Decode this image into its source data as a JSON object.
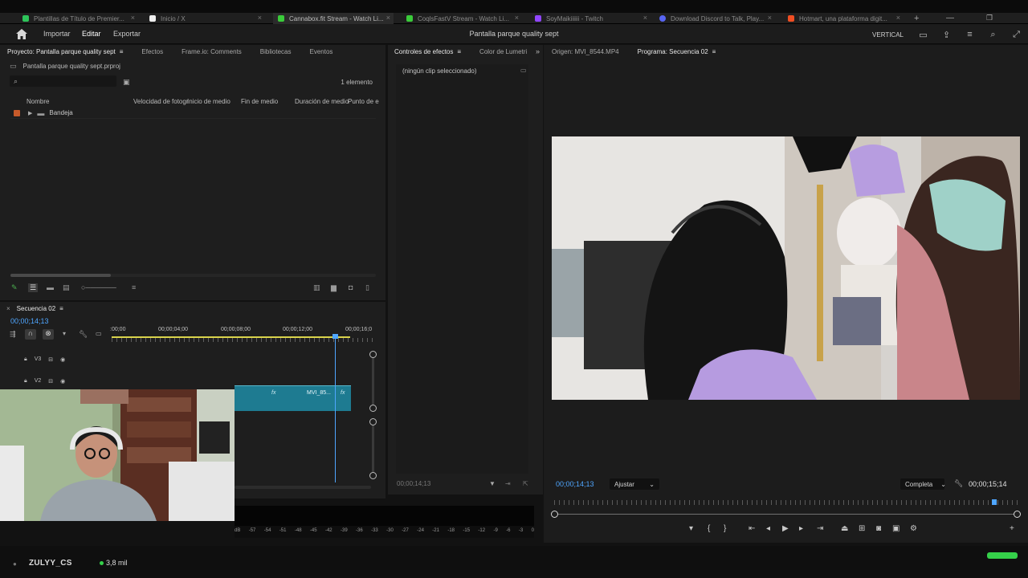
{
  "browser": {
    "tabs": [
      {
        "label": "Plantillas de Título de Premier...",
        "color": "#2ec45a"
      },
      {
        "label": "Inicio / X",
        "color": "#ffffff"
      },
      {
        "label": "Cannabox.fit Stream - Watch Li...",
        "color": "#3acb3a"
      },
      {
        "label": "CoqlsFastV Stream - Watch Li...",
        "color": "#3acb3a"
      },
      {
        "label": "SoyMaikiiiiii - Twitch",
        "color": "#9146ff"
      },
      {
        "label": "Download Discord to Talk, Play...",
        "color": "#5865f2"
      },
      {
        "label": "Hotmart, una plataforma digit...",
        "color": "#f04e23"
      }
    ]
  },
  "app": {
    "menu": [
      "Importar",
      "Editar",
      "Exportar"
    ],
    "active_menu": "Editar",
    "title": "Pantalla parque quality sept",
    "workspace": "VERTICAL"
  },
  "project": {
    "tabs": [
      "Proyecto: Pantalla parque quality sept",
      "Efectos",
      "Frame.io: Comments",
      "Bibliotecas",
      "Eventos"
    ],
    "file": "Pantalla parque quality sept.prproj",
    "count": "1 elemento",
    "columns": [
      "Nombre",
      "Velocidad de fotogr",
      "Inicio de medio",
      "Fin de medio",
      "Duración de medio",
      "Punto de e"
    ],
    "bin": "Bandeja",
    "bin_color": "#c75a2a"
  },
  "timeline": {
    "sequence": "Secuencia 02",
    "timecode": "00;00;14;13",
    "ruler": [
      ":00;00",
      "00;00;04;00",
      "00;00;08;00",
      "00;00;12;00",
      "00;00;16;0"
    ],
    "tracks": [
      "V3",
      "V2"
    ],
    "clip_label": "MVI_85..."
  },
  "effects": {
    "tabs": [
      "Controles de efectos",
      "Color de Lumetri"
    ],
    "empty": "(ningún clip seleccionado)",
    "timecode": "00;00;14;13"
  },
  "monitor": {
    "source_tab": "Origen: MVI_8544.MP4",
    "program_tab": "Programa: Secuencia 02",
    "timecode": "00;00;14;13",
    "fit": "Ajustar",
    "quality": "Completa",
    "duration": "00;00;15;14",
    "playhead_fraction": 0.949
  },
  "meter": {
    "scale": [
      "dB",
      "-57",
      "-54",
      "-51",
      "-48",
      "-45",
      "-42",
      "-39",
      "-36",
      "-33",
      "-30",
      "-27",
      "-24",
      "-21",
      "-18",
      "-15",
      "-12",
      "-9",
      "-6",
      "-3",
      "0"
    ]
  },
  "stream": {
    "channel": "ZULYY_CS",
    "viewers": "3,8 mil"
  }
}
